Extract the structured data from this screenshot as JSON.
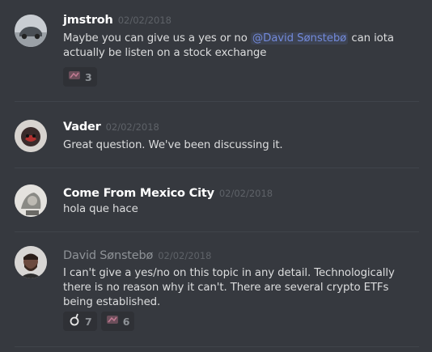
{
  "messages": [
    {
      "username": "jmstroh",
      "timestamp": "02/02/2018",
      "text_before_mention": "Maybe you can give us a yes or no ",
      "mention": "@David Sønstebø",
      "text_after_mention": " can iota actually be listen on a stock exchange",
      "reactions": [
        {
          "icon": "custom-emoji-icon",
          "count": "3"
        }
      ]
    },
    {
      "username": "Vader",
      "timestamp": "02/02/2018",
      "text": "Great question. We've been discussing it."
    },
    {
      "username": "Come From Mexico City",
      "timestamp": "02/02/2018",
      "text": "hola que hace"
    },
    {
      "username": "David Sønstebø",
      "timestamp": "02/02/2018",
      "text": "I can't give a yes/no on this topic in any detail. Technologically there is no reason why it can't. There are several crypto ETFs being established.",
      "reactions": [
        {
          "icon": "custom-emoji-icon",
          "count": "7"
        },
        {
          "icon": "custom-emoji-icon",
          "count": "6"
        }
      ]
    }
  ],
  "colors": {
    "background": "#36393f",
    "mention": "#7289da",
    "username": "#ffffff",
    "timestamp": "#5e6268",
    "reaction_bg": "#2f3136"
  }
}
